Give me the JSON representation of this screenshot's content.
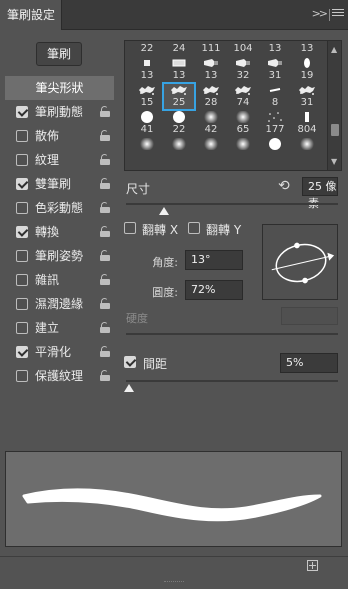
{
  "panel": {
    "tab_title": "筆刷設定",
    "collapse_icon": "double-chevron-right-icon",
    "menu_icon": "hamburger-menu-icon"
  },
  "brushes_button": "筆刷",
  "sidebar": {
    "items": [
      {
        "label": "筆尖形狀",
        "checkbox": null,
        "locked": false,
        "active": true
      },
      {
        "label": "筆刷動態",
        "checkbox": true,
        "locked": true
      },
      {
        "label": "散佈",
        "checkbox": false,
        "locked": true
      },
      {
        "label": "紋理",
        "checkbox": false,
        "locked": true
      },
      {
        "label": "雙筆刷",
        "checkbox": true,
        "locked": true
      },
      {
        "label": "色彩動態",
        "checkbox": false,
        "locked": true
      },
      {
        "label": "轉換",
        "checkbox": true,
        "locked": true
      },
      {
        "label": "筆刷姿勢",
        "checkbox": false,
        "locked": true
      },
      {
        "label": "雜訊",
        "checkbox": false,
        "locked": true
      },
      {
        "label": "濕潤邊緣",
        "checkbox": false,
        "locked": true
      },
      {
        "label": "建立",
        "checkbox": false,
        "locked": true
      },
      {
        "label": "平滑化",
        "checkbox": true,
        "locked": true
      },
      {
        "label": "保護紋理",
        "checkbox": false,
        "locked": true
      }
    ]
  },
  "brush_grid": {
    "rows": [
      {
        "cells": [
          {
            "num": "22",
            "kind": "square"
          },
          {
            "num": "24",
            "kind": "rect"
          },
          {
            "num": "111",
            "kind": "cone"
          },
          {
            "num": "104",
            "kind": "cone"
          },
          {
            "num": "13",
            "kind": "cone"
          },
          {
            "num": "13",
            "kind": "oval"
          }
        ]
      },
      {
        "cells": [
          {
            "num": "15",
            "kind": "splatter"
          },
          {
            "num": "25",
            "kind": "splatter",
            "selected": true
          },
          {
            "num": "28",
            "kind": "splatter"
          },
          {
            "num": "74",
            "kind": "splatter"
          },
          {
            "num": "8",
            "kind": "stroke"
          },
          {
            "num": "31",
            "kind": "splatter"
          }
        ]
      },
      {
        "cells": [
          {
            "num": "41",
            "kind": "hard"
          },
          {
            "num": "22",
            "kind": "hard"
          },
          {
            "num": "42",
            "kind": "soft"
          },
          {
            "num": "65",
            "kind": "soft"
          },
          {
            "num": "177",
            "kind": "dots"
          },
          {
            "num": "804",
            "kind": "bar"
          }
        ]
      },
      {
        "cells": [
          {
            "num": "",
            "kind": "soft"
          },
          {
            "num": "",
            "kind": "soft"
          },
          {
            "num": "",
            "kind": "soft"
          },
          {
            "num": "",
            "kind": "soft"
          },
          {
            "num": "",
            "kind": "hard"
          },
          {
            "num": "",
            "kind": "soft"
          }
        ]
      }
    ],
    "top_row_labels": [
      "22",
      "24",
      "111",
      "104",
      "13",
      "13"
    ],
    "second_row_labels": [
      "13",
      "13",
      "13",
      "32",
      "31",
      "19"
    ]
  },
  "size": {
    "label": "尺寸",
    "value": "25 像素",
    "slider_fraction": 0.06
  },
  "flip_x": {
    "label": "翻轉 X",
    "checked": false
  },
  "flip_y": {
    "label": "翻轉 Y",
    "checked": false
  },
  "angle": {
    "label": "角度:",
    "value": "13°"
  },
  "roundness": {
    "label": "圓度:",
    "value": "72%"
  },
  "hardness": {
    "label": "硬度",
    "value": ""
  },
  "spacing": {
    "label": "間距",
    "checked": true,
    "value": "5%",
    "slider_fraction": 0.0
  },
  "footer": {
    "new_icon": "new-brush-icon"
  }
}
